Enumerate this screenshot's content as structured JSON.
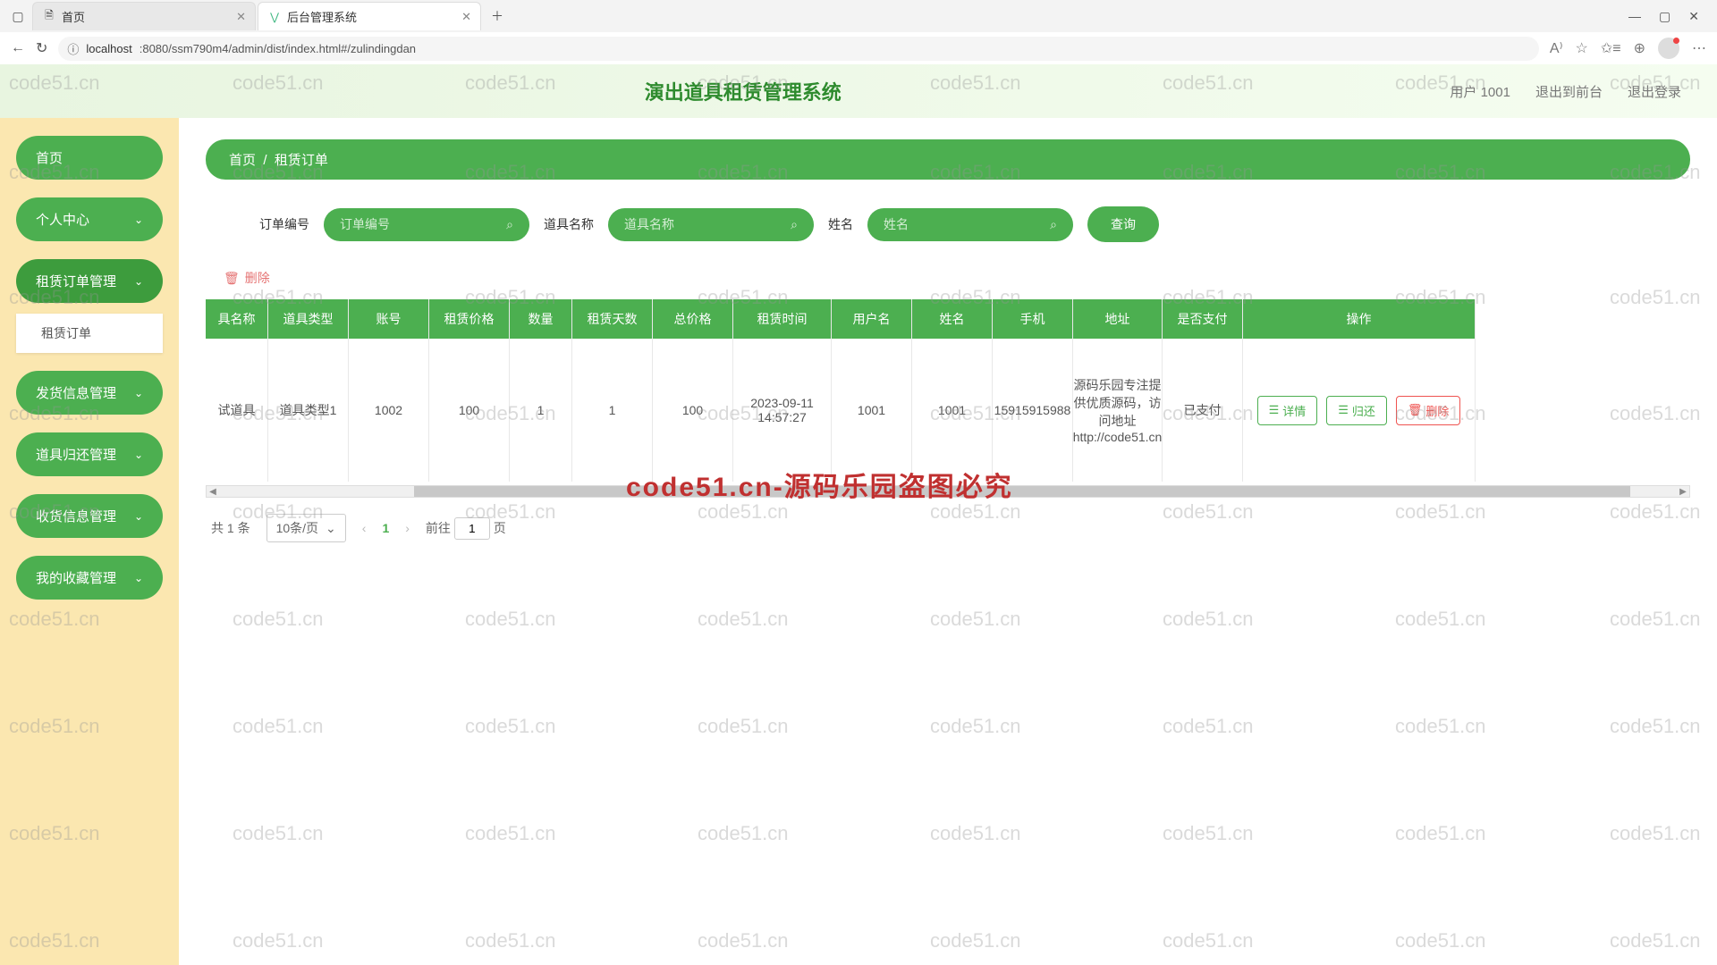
{
  "browser": {
    "tabs": [
      {
        "title": "首页"
      },
      {
        "title": "后台管理系统"
      }
    ],
    "url_host": "localhost",
    "url_path": ":8080/ssm790m4/admin/dist/index.html#/zulindingdan"
  },
  "header": {
    "title": "演出道具租赁管理系统",
    "user": "用户 1001",
    "logout_front": "退出到前台",
    "logout": "退出登录"
  },
  "sidebar": {
    "items": [
      {
        "label": "首页",
        "expandable": false
      },
      {
        "label": "个人中心",
        "expandable": true
      },
      {
        "label": "租赁订单管理",
        "expandable": true,
        "active": true,
        "sub": "租赁订单"
      },
      {
        "label": "发货信息管理",
        "expandable": true
      },
      {
        "label": "道具归还管理",
        "expandable": true
      },
      {
        "label": "收货信息管理",
        "expandable": true
      },
      {
        "label": "我的收藏管理",
        "expandable": true
      }
    ]
  },
  "breadcrumb": {
    "home": "首页",
    "sep": "/",
    "current": "租赁订单"
  },
  "search": {
    "fields": [
      {
        "label": "订单编号",
        "placeholder": "订单编号"
      },
      {
        "label": "道具名称",
        "placeholder": "道具名称"
      },
      {
        "label": "姓名",
        "placeholder": "姓名"
      }
    ],
    "button": "查询"
  },
  "toolbar": {
    "delete": "删除"
  },
  "table": {
    "columns": [
      "具名称",
      "道具类型",
      "账号",
      "租赁价格",
      "数量",
      "租赁天数",
      "总价格",
      "租赁时间",
      "用户名",
      "姓名",
      "手机",
      "地址",
      "是否支付",
      "操作"
    ],
    "row": {
      "name": "试道具",
      "type": "道具类型1",
      "account": "1002",
      "price": "100",
      "qty": "1",
      "days": "1",
      "total": "100",
      "time": "2023-09-11 14:57:27",
      "user": "1001",
      "realname": "1001",
      "phone": "15915915988",
      "addr": "源码乐园专注提供优质源码，访问地址http://code51.cn",
      "paid": "已支付"
    },
    "actions": {
      "detail": "详情",
      "return": "归还",
      "delete": "删除"
    }
  },
  "pager": {
    "total": "共 1 条",
    "pagesize": "10条/页",
    "current": "1",
    "jump_prefix": "前往",
    "jump_value": "1",
    "jump_suffix": "页"
  },
  "overlay": "code51.cn-源码乐园盗图必究",
  "watermark": "code51.cn"
}
